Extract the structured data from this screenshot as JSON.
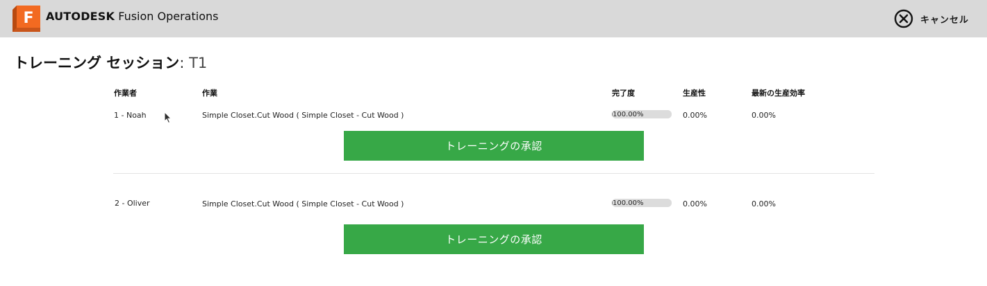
{
  "header": {
    "brand_bold": "AUTODESK",
    "brand_product": "Fusion Operations",
    "logo_letter": "F",
    "cancel_label": "キャンセル",
    "cancel_icon": "close-circle-icon"
  },
  "page": {
    "title_main": "トレーニング セッション",
    "title_separator": ": ",
    "title_value": "T1"
  },
  "table": {
    "columns": {
      "operator": "作業者",
      "task": "作業",
      "completion": "完了度",
      "productivity": "生産性",
      "latest_efficiency": "最新の生産効率"
    },
    "rows": [
      {
        "operator": "1 - Noah",
        "task": "Simple Closet.Cut Wood ( Simple Closet - Cut Wood )",
        "completion": "100.00%",
        "completion_value": 100,
        "productivity": "0.00%",
        "latest_efficiency": "0.00%",
        "approve_label": "トレーニングの承認"
      },
      {
        "operator": "2 - Oliver",
        "task": "Simple Closet.Cut Wood ( Simple Closet - Cut Wood )",
        "completion": "100.00%",
        "completion_value": 100,
        "productivity": "0.00%",
        "latest_efficiency": "0.00%",
        "approve_label": "トレーニングの承認"
      }
    ]
  },
  "colors": {
    "topbar_bg": "#d9d9d9",
    "approve_button": "#37a847",
    "logo_orange": "#f26a21"
  }
}
